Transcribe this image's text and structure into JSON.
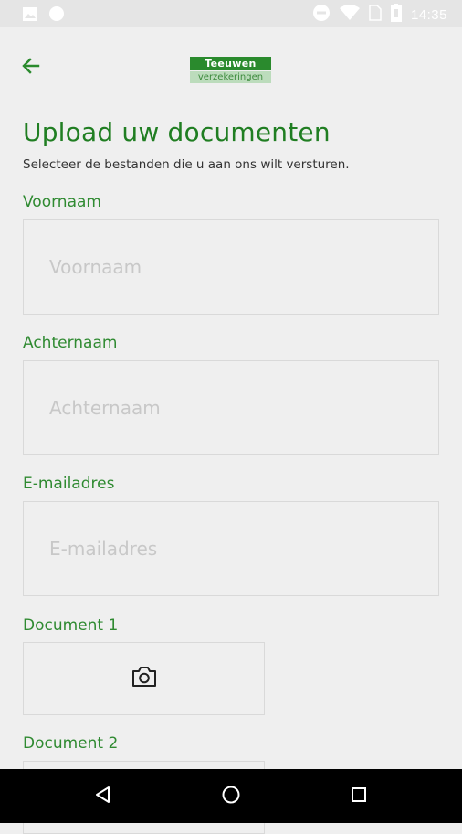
{
  "status_bar": {
    "time": "14:35",
    "icons": [
      "image-icon",
      "circle-icon",
      "minus-circle-icon",
      "wifi-icon",
      "no-sim-icon",
      "battery-icon"
    ]
  },
  "header": {
    "back_icon": "arrow-left-icon",
    "logo": {
      "line1": "Teeuwen",
      "line2": "verzekeringen"
    }
  },
  "main": {
    "title": "Upload uw documenten",
    "subtitle": "Selecteer de bestanden die u aan ons wilt versturen.",
    "fields": [
      {
        "label": "Voornaam",
        "placeholder": "Voornaam",
        "value": ""
      },
      {
        "label": "Achternaam",
        "placeholder": "Achternaam",
        "value": ""
      },
      {
        "label": "E-mailadres",
        "placeholder": "E-mailadres",
        "value": ""
      }
    ],
    "documents": [
      {
        "label": "Document 1",
        "icon": "camera-icon"
      },
      {
        "label": "Document 2",
        "icon": "camera-icon"
      }
    ]
  },
  "nav_bar": {
    "buttons": [
      "back-triangle-icon",
      "home-circle-icon",
      "recents-square-icon"
    ]
  },
  "colors": {
    "brand_green": "#207e22",
    "label_green": "#2f8a31",
    "background": "#efefef",
    "border": "#d9d9d9"
  }
}
